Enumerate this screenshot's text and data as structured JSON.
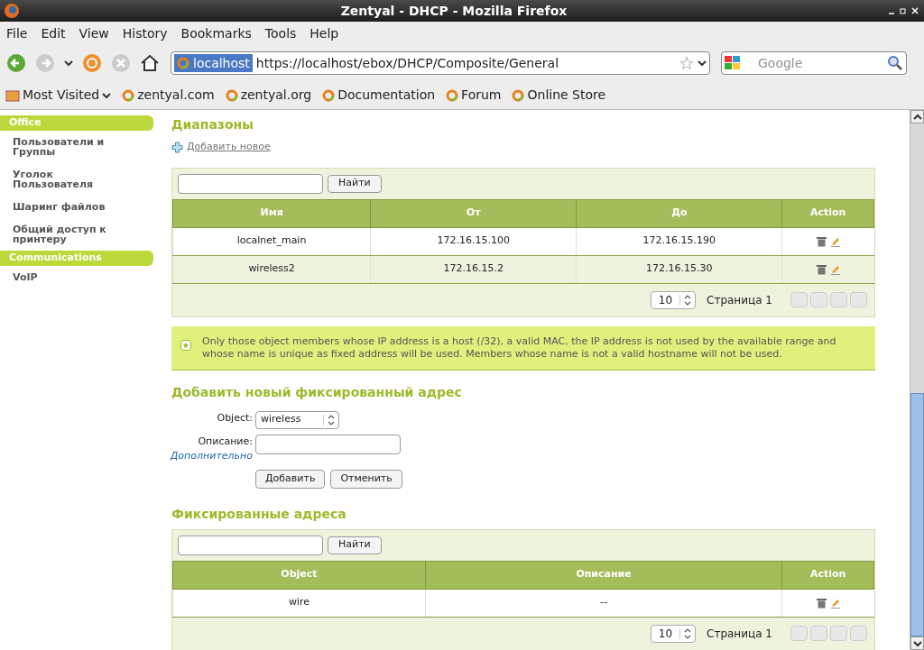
{
  "window": {
    "title": "Zentyal - DHCP - Mozilla Firefox"
  },
  "menu": [
    "File",
    "Edit",
    "View",
    "History",
    "Bookmarks",
    "Tools",
    "Help"
  ],
  "address_bar": {
    "site": "localhost",
    "url": "https://localhost/ebox/DHCP/Composite/General"
  },
  "search": {
    "placeholder": "Google"
  },
  "bookmarks": [
    {
      "label": "Most Visited",
      "kind": "folder"
    },
    {
      "label": "zentyal.com",
      "kind": "link"
    },
    {
      "label": "zentyal.org",
      "kind": "link"
    },
    {
      "label": "Documentation",
      "kind": "link"
    },
    {
      "label": "Forum",
      "kind": "link"
    },
    {
      "label": "Online Store",
      "kind": "link"
    }
  ],
  "sidebar": [
    {
      "label": "Office",
      "kind": "header"
    },
    {
      "label": "Пользователи и Группы",
      "kind": "item"
    },
    {
      "label": "Уголок Пользователя",
      "kind": "item"
    },
    {
      "label": "Шаринг файлов",
      "kind": "item"
    },
    {
      "label": "Общий доступ к принтеру",
      "kind": "item"
    },
    {
      "label": "Communications",
      "kind": "header"
    },
    {
      "label": "VoIP",
      "kind": "item"
    }
  ],
  "ranges": {
    "title": "Диапазоны",
    "add_link": "Добавить новое",
    "search_button": "Найти",
    "columns": [
      "Имя",
      "От",
      "До",
      "Action"
    ],
    "rows": [
      [
        "localnet_main",
        "172.16.15.100",
        "172.16.15.190"
      ],
      [
        "wireless2",
        "172.16.15.2",
        "172.16.15.30"
      ]
    ],
    "page_size": "10",
    "page": "Страница 1"
  },
  "note": "Only those object members whose IP address is a host (/32), a valid MAC, the IP address is not used by the available range and whose name is unique as fixed address will be used. Members whose name is not a valid hostname will not be used.",
  "add_fixed": {
    "title": "Добавить новый фиксированный адрес",
    "object_label": "Object:",
    "object_value": "wireless",
    "description_label": "Описание:",
    "advanced_link": "Дополнительно",
    "buttons": [
      "Добавить",
      "Отменить"
    ]
  },
  "fixed": {
    "title": "Фиксированные адреса",
    "search_button": "Найти",
    "columns": [
      "Object",
      "Описание",
      "Action"
    ],
    "rows": [
      [
        "wire",
        "--"
      ]
    ],
    "page_size": "10",
    "page": "Страница 1"
  }
}
